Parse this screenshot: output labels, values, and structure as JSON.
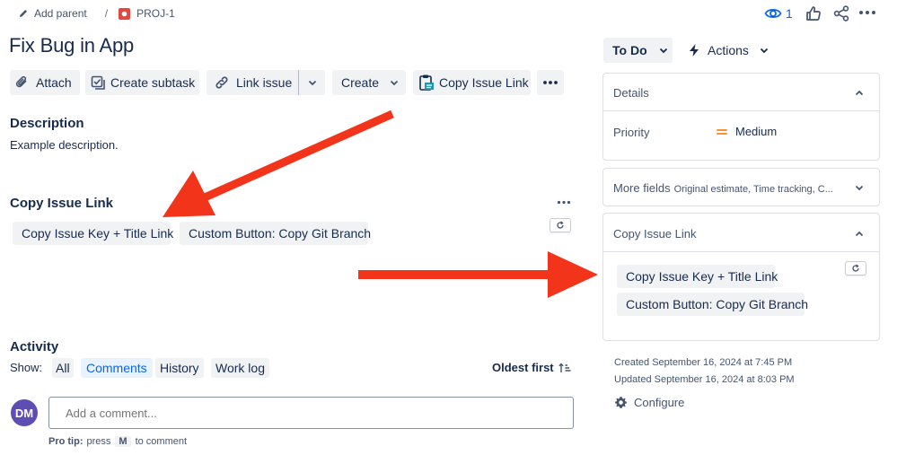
{
  "breadcrumb": {
    "add_parent": "Add parent",
    "separator": "/",
    "project_key": "PROJ-1"
  },
  "topbar": {
    "watch_count": "1"
  },
  "issue": {
    "title": "Fix Bug in App"
  },
  "toolbar": {
    "attach": "Attach",
    "create_subtask": "Create subtask",
    "link_issue": "Link issue",
    "create": "Create",
    "copy_issue_link": "Copy Issue Link"
  },
  "description": {
    "heading": "Description",
    "text": "Example description."
  },
  "copy_panel_main": {
    "heading": "Copy Issue Link",
    "buttons": [
      "Copy Issue Key + Title Link",
      "Custom Button: Copy Git Branch"
    ]
  },
  "activity": {
    "heading": "Activity",
    "show_label": "Show:",
    "filters": [
      "All",
      "Comments",
      "History",
      "Work log"
    ],
    "sort_label": "Oldest first",
    "avatar_initials": "DM",
    "comment_placeholder": "Add a comment...",
    "pro_tip_label": "Pro tip:",
    "pro_tip_press": "press",
    "pro_tip_key": "M",
    "pro_tip_suffix": "to comment"
  },
  "sidebar": {
    "status": "To Do",
    "actions": "Actions",
    "details": {
      "heading": "Details",
      "priority_label": "Priority",
      "priority_value": "Medium"
    },
    "more_fields": {
      "label": "More fields",
      "summary": "Original estimate, Time tracking, C..."
    },
    "copy_panel": {
      "heading": "Copy Issue Link",
      "buttons": [
        "Copy Issue Key + Title Link",
        "Custom Button: Copy Git Branch"
      ]
    },
    "created": "Created September 16, 2024 at 7:45 PM",
    "updated": "Updated September 16, 2024 at 8:03 PM",
    "configure": "Configure"
  },
  "colors": {
    "accent": "#0c66e4",
    "arrow": "#f1341a",
    "priority": "#f79232",
    "avatar": "#5e4db2",
    "project_icon": "#e2483d"
  }
}
